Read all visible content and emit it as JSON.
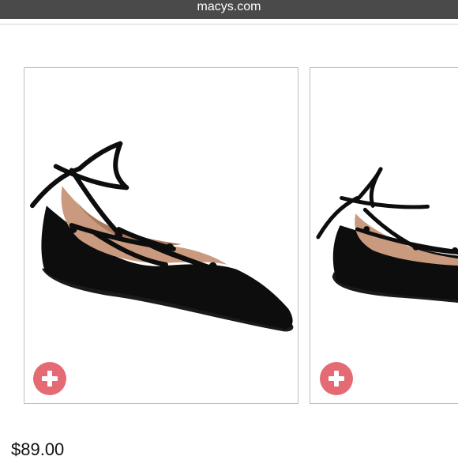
{
  "header": {
    "site": "macys.com"
  },
  "products": [
    {
      "image_icon": "lace-up-flat-shoe",
      "add_icon": "plus-icon",
      "price": "$89.00"
    },
    {
      "image_icon": "lace-up-flat-shoe",
      "add_icon": "plus-icon"
    }
  ],
  "colors": {
    "topbar": "#4a4a4a",
    "add_button": "#e46b74",
    "shoe": "#0d0d0d",
    "lining": "#c99a7e"
  }
}
